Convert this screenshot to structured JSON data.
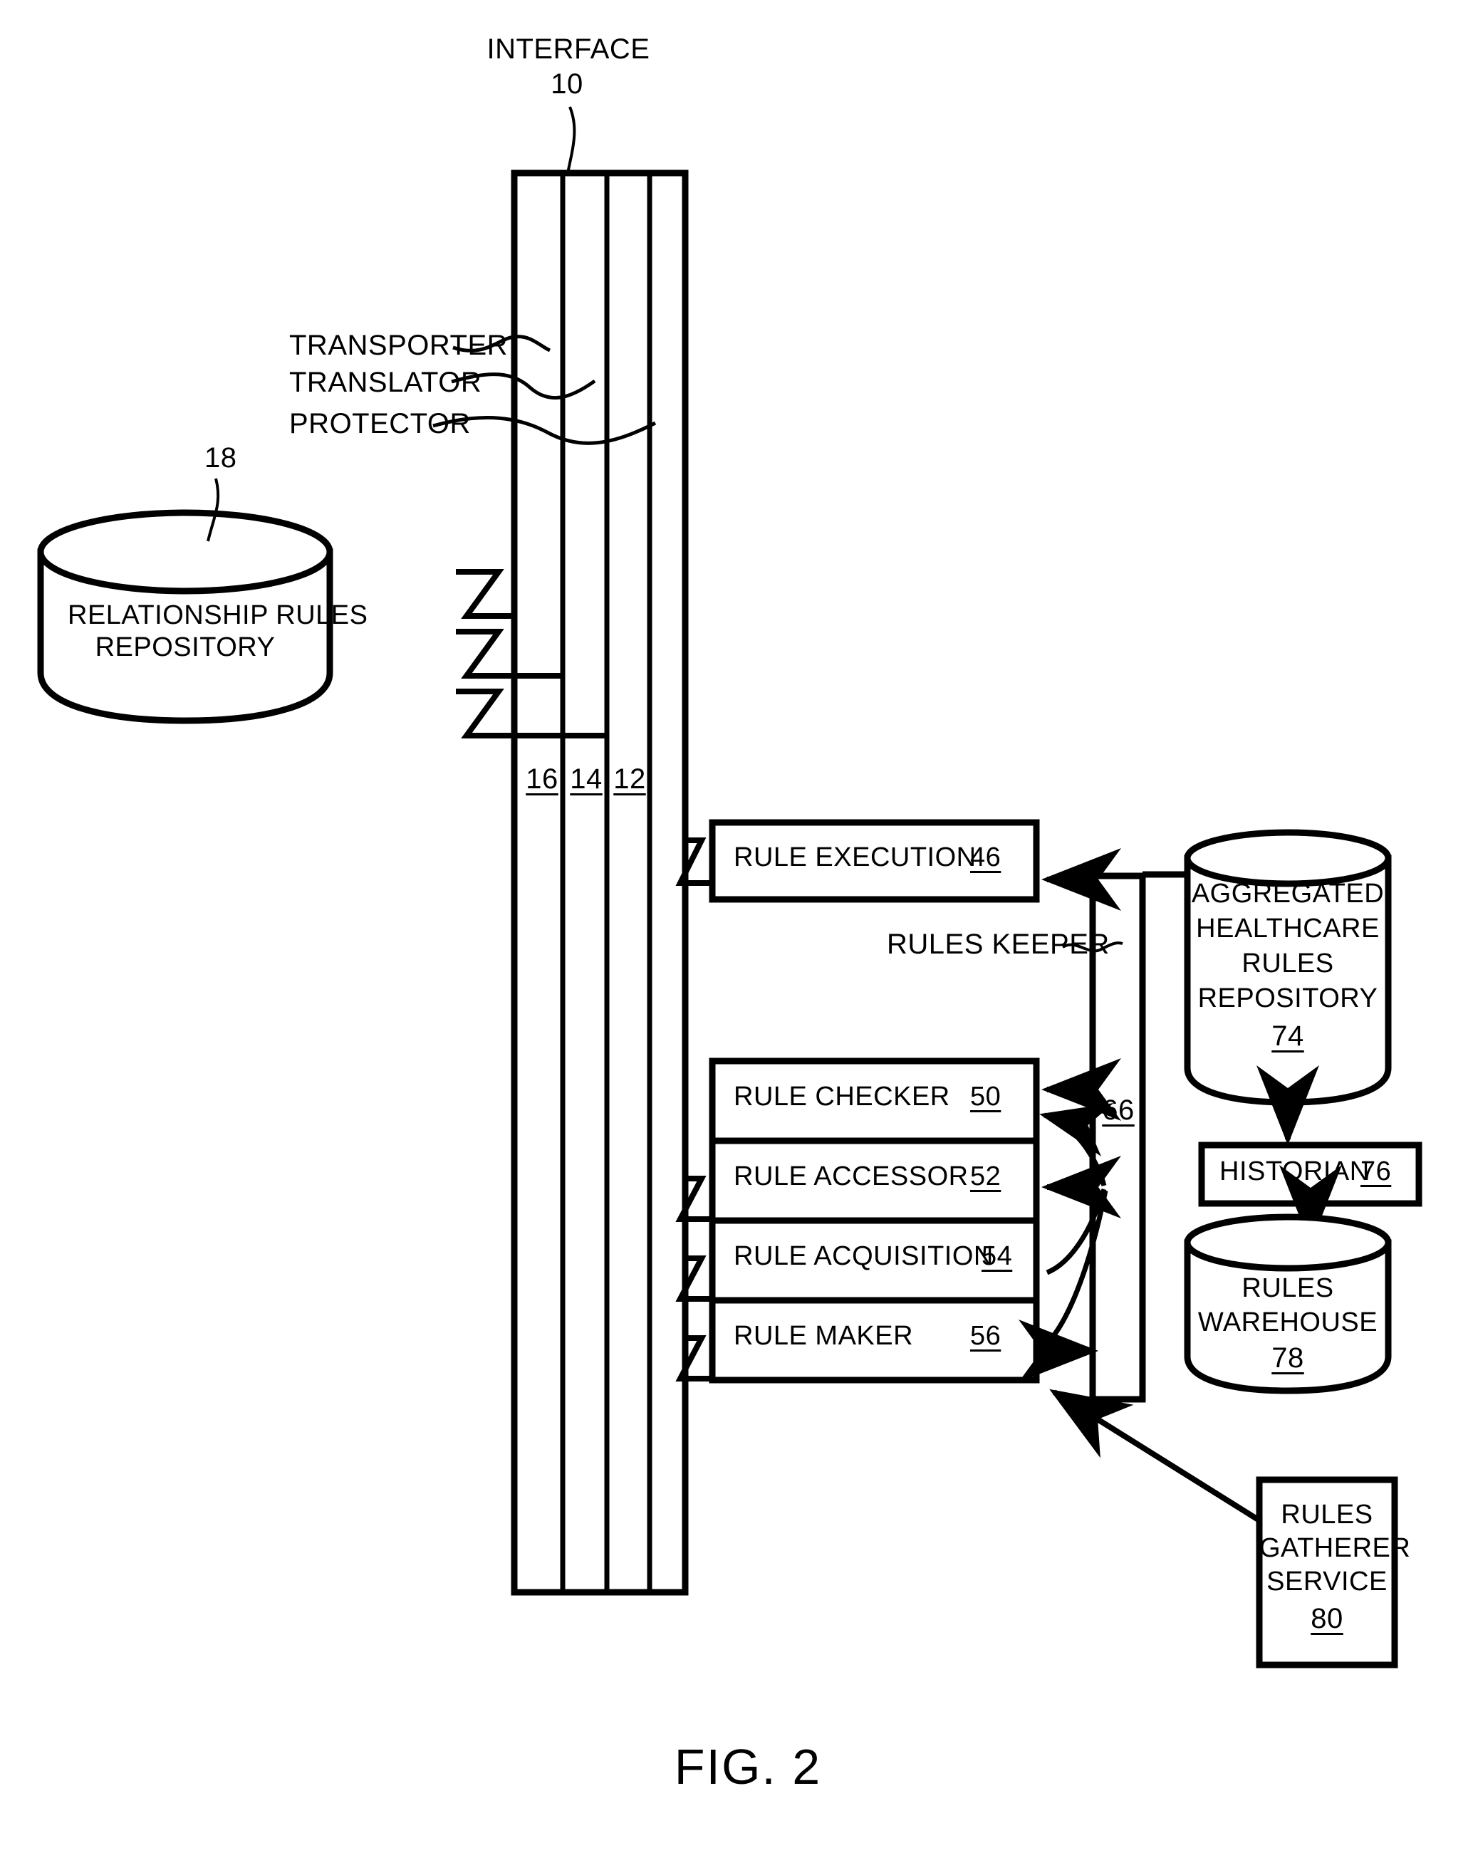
{
  "figure": {
    "caption": "FIG. 2",
    "title_label": "INTERFACE",
    "title_ref": "10"
  },
  "interface": {
    "name": "INTERFACE",
    "ref": "10",
    "layer_labels": [
      {
        "label": "TRANSPORTER"
      },
      {
        "label": "TRANSLATOR"
      },
      {
        "label": "PROTECTOR"
      }
    ],
    "layer_refs": [
      {
        "ref": "16"
      },
      {
        "ref": "14"
      },
      {
        "ref": "12"
      }
    ]
  },
  "relationship_repository": {
    "line1": "RELATIONSHIP RULES",
    "line2": "REPOSITORY",
    "ref": "18"
  },
  "rule_execution": {
    "label": "RULE EXECUTION",
    "ref": "46"
  },
  "rules_keeper": {
    "label": "RULES KEEPER",
    "ref": "66"
  },
  "rule_stack": [
    {
      "label": "RULE CHECKER",
      "ref": "50"
    },
    {
      "label": "RULE ACCESSOR",
      "ref": "52"
    },
    {
      "label": "RULE ACQUISITION",
      "ref": "54"
    },
    {
      "label": "RULE MAKER",
      "ref": "56"
    }
  ],
  "aggregated_repository": {
    "line1": "AGGREGATED",
    "line2": "HEALTHCARE",
    "line3": "RULES",
    "line4": "REPOSITORY",
    "ref": "74"
  },
  "historian": {
    "label": "HISTORIAN",
    "ref": "76"
  },
  "rules_warehouse": {
    "line1": "RULES",
    "line2": "WAREHOUSE",
    "ref": "78"
  },
  "rules_gatherer": {
    "line1": "RULES",
    "line2": "GATHERER",
    "line3": "SERVICE",
    "ref": "80"
  },
  "colors": {
    "ink": "#000000",
    "paper": "#ffffff"
  }
}
